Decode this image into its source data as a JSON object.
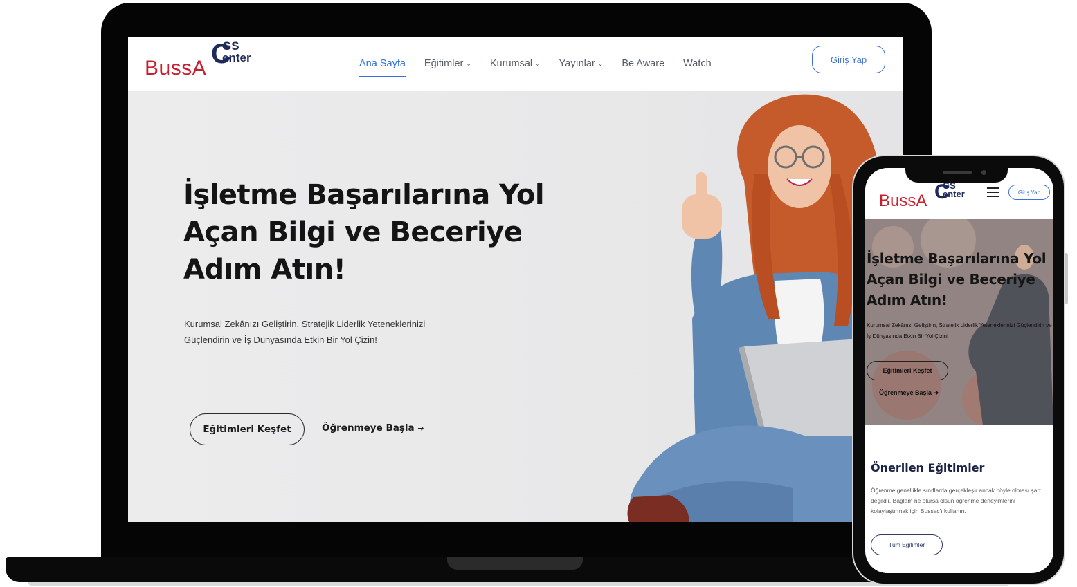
{
  "brand": {
    "buss": "BussA",
    "c": "C",
    "gs": "GS",
    "center": "enter",
    "color_red": "#c8202e",
    "color_navy": "#1f2a5a"
  },
  "desktop": {
    "nav": [
      {
        "label": "Ana Sayfa",
        "active": true,
        "caret": false
      },
      {
        "label": "Eğitimler",
        "active": false,
        "caret": true
      },
      {
        "label": "Kurumsal",
        "active": false,
        "caret": true
      },
      {
        "label": "Yayınlar",
        "active": false,
        "caret": true
      },
      {
        "label": "Be Aware",
        "active": false,
        "caret": false
      },
      {
        "label": "Watch",
        "active": false,
        "caret": false
      }
    ],
    "login": "Giriş Yap",
    "hero": {
      "title": "İşletme Başarılarına Yol Açan Bilgi ve Beceriye Adım Atın!",
      "subtitle": "Kurumsal Zekânızı Geliştirin, Stratejik Liderlik Yeteneklerinizi Güçlendirin ve İş Dünyasında Etkin Bir Yol Çizin!",
      "primary_button": "Eğitimleri Keşfet",
      "secondary_link": "Öğrenmeye Başla",
      "arrow": "➔"
    },
    "accent": "#2f6fe0"
  },
  "mobile": {
    "login": "Giriş Yap",
    "hero": {
      "title_line1": "İşletme Başarılarına Yol",
      "title_line2": "Açan Bilgi ve Beceriye",
      "title_line3": "Adım Atın!",
      "subtitle": "Kurumsal Zekânızı Geliştirin, Stratejik Liderlik Yeteneklerinizi Güçlendirin ve İş Dünyasında Etkin Bir Yol Çizin!",
      "primary_button": "Eğitimleri Keşfet",
      "secondary_link": "Öğrenmeye Başla",
      "arrow": "➔"
    },
    "section": {
      "title": "Önerilen Eğitimler",
      "text": "Öğrenme genellikle sınıflarda gerçekleşir ancak böyle olması şart değildir. Bağlam ne olursa olsun öğrenme deneyimlerini kolaylaştırmak için Bussac'ı kullanın.",
      "button": "Tüm Eğitimler"
    }
  }
}
